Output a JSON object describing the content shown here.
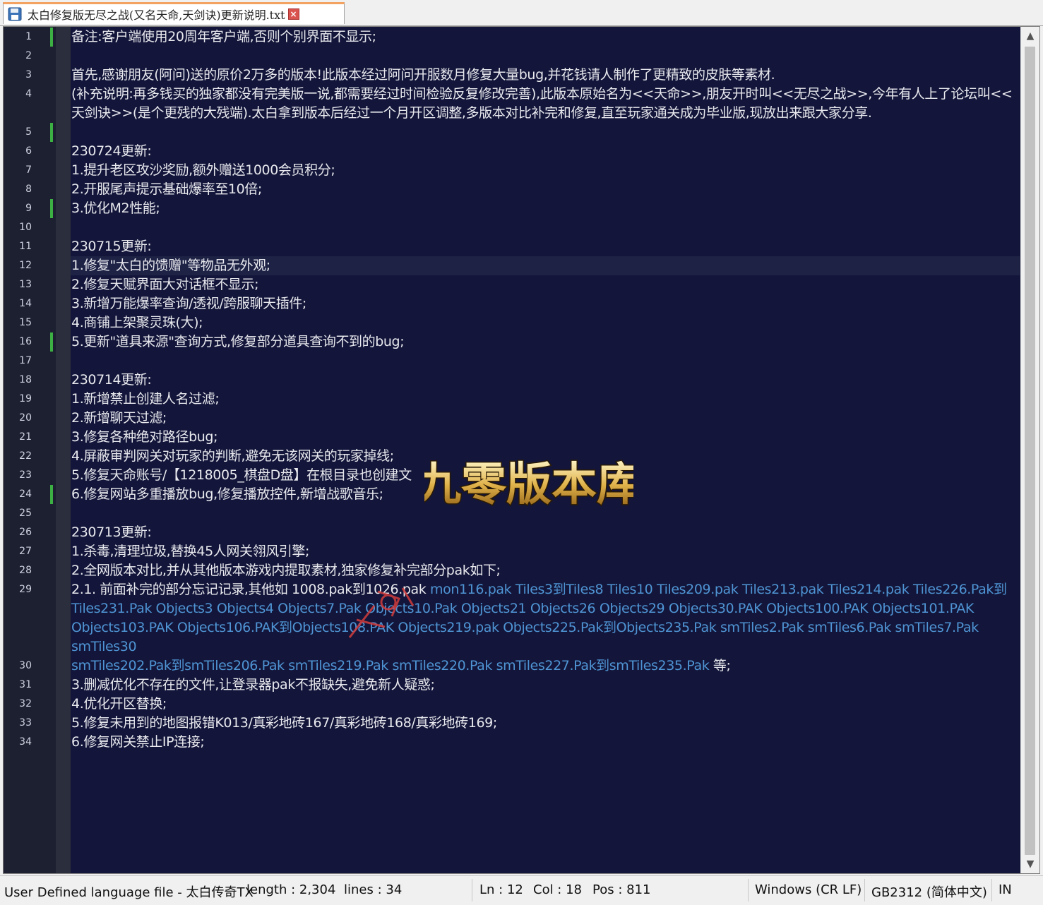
{
  "tab": {
    "title": "太白修复版无尽之战(又名天命,天剑诀)更新说明.txt",
    "icon": "save-icon",
    "close_icon": "close-icon"
  },
  "editor": {
    "current_line": 12,
    "lines": [
      {
        "n": "1",
        "marker": true,
        "text": "备注:客户端使用20周年客户端,否则个别界面不显示;"
      },
      {
        "n": "2",
        "marker": false,
        "text": ""
      },
      {
        "n": "3",
        "marker": false,
        "text": "首先,感谢朋友(阿问)送的原价2万多的版本!此版本经过阿问开服数月修复大量bug,并花钱请人制作了更精致的皮肤等素材."
      },
      {
        "n": "4",
        "marker": false,
        "text": "(补充说明:再多钱买的独家都没有完美版一说,都需要经过时间检验反复修改完善),此版本原始名为<<天命>>,朋友开时叫<<无尽之战>>,今年有人上了论坛叫<<天剑诀>>(是个更残的大残端).太白拿到版本后经过一个月开区调整,多版本对比补完和修复,直至玩家通关成为毕业版,现放出来跟大家分享."
      },
      {
        "n": "5",
        "marker": true,
        "text": ""
      },
      {
        "n": "6",
        "marker": false,
        "text": "230724更新:"
      },
      {
        "n": "7",
        "marker": false,
        "text": "1.提升老区攻沙奖励,额外赠送1000会员积分;"
      },
      {
        "n": "8",
        "marker": false,
        "text": "2.开服尾声提示基础爆率至10倍;"
      },
      {
        "n": "9",
        "marker": true,
        "text": "3.优化M2性能;"
      },
      {
        "n": "10",
        "marker": false,
        "text": ""
      },
      {
        "n": "11",
        "marker": false,
        "text": "230715更新:"
      },
      {
        "n": "12",
        "marker": false,
        "text": "1.修复\"太白的馈赠\"等物品无外观;"
      },
      {
        "n": "13",
        "marker": false,
        "text": "2.修复天赋界面大对话框不显示;"
      },
      {
        "n": "14",
        "marker": false,
        "text": "3.新增万能爆率查询/透视/跨服聊天插件;"
      },
      {
        "n": "15",
        "marker": false,
        "text": "4.商铺上架聚灵珠(大);"
      },
      {
        "n": "16",
        "marker": true,
        "text": "5.更新\"道具来源\"查询方式,修复部分道具查询不到的bug;"
      },
      {
        "n": "17",
        "marker": false,
        "text": ""
      },
      {
        "n": "18",
        "marker": false,
        "text": "230714更新:"
      },
      {
        "n": "19",
        "marker": false,
        "text": "1.新增禁止创建人名过滤;"
      },
      {
        "n": "20",
        "marker": false,
        "text": "2.新增聊天过滤;"
      },
      {
        "n": "21",
        "marker": false,
        "text": "3.修复各种绝对路径bug;"
      },
      {
        "n": "22",
        "marker": false,
        "text": "4.屏蔽审判网关对玩家的判断,避免无该网关的玩家掉线;"
      },
      {
        "n": "23",
        "marker": false,
        "text": "5.修复天命账号/【1218005_棋盘D盘】在根目录也创建文"
      },
      {
        "n": "24",
        "marker": true,
        "text": "6.修复网站多重播放bug,修复播放控件,新增战歌音乐;"
      },
      {
        "n": "25",
        "marker": false,
        "text": ""
      },
      {
        "n": "26",
        "marker": false,
        "text": "230713更新:"
      },
      {
        "n": "27",
        "marker": false,
        "text": "1.杀毒,清理垃圾,替换45人网关翎风引擎;"
      },
      {
        "n": "28",
        "marker": false,
        "text": "2.全网版本对比,并从其他版本游戏内提取素材,独家修复补完部分pak如下;"
      },
      {
        "n": "29",
        "marker": false,
        "text": "2.1. 前面补完的部分忘记记录,其他如 1008.pak到1026.pak ",
        "hl": "mon116.pak Tiles3到Tiles8 Tiles10 Tiles209.pak Tiles213.pak Tiles214.pak Tiles226.Pak到Tiles231.Pak Objects3 Objects4 Objects7.Pak Objects10.Pak Objects21 Objects26 Objects29 Objects30.PAK Objects100.PAK Objects101.PAK Objects103.PAK Objects106.PAK到Objects108.PAK Objects219.pak Objects225.Pak到Objects235.Pak smTiles2.Pak smTiles6.Pak smTiles7.Pak smTiles30"
      },
      {
        "n": "30",
        "marker": false,
        "text": "",
        "hl": "smTiles202.Pak到smTiles206.Pak smTiles219.Pak smTiles220.Pak smTiles227.Pak到smTiles235.Pak",
        "tail": " 等;"
      },
      {
        "n": "31",
        "marker": false,
        "text": "3.删减优化不存在的文件,让登录器pak不报缺失,避免新人疑惑;"
      },
      {
        "n": "32",
        "marker": false,
        "text": "4.优化开区替换;"
      },
      {
        "n": "33",
        "marker": false,
        "text": "5.修复未用到的地图报错K013/真彩地砖167/真彩地砖168/真彩地砖169;"
      },
      {
        "n": "34",
        "marker": false,
        "text": "6.修复网关禁止IP连接;"
      }
    ]
  },
  "watermark": {
    "text": "九零版本库"
  },
  "statusbar": {
    "lang": "User Defined language file - 太白传奇TX",
    "length": "length : 2,304",
    "lines": "lines : 34",
    "ln": "Ln : 12",
    "col": "Col : 18",
    "pos": "Pos : 811",
    "eol": "Windows (CR LF)",
    "encoding": "GB2312 (简体中文)",
    "mode": "IN"
  },
  "colors": {
    "editor_bg": "#13163a",
    "text": "#e8e8ee",
    "link": "#4f94d4",
    "marker": "#3cb043"
  }
}
